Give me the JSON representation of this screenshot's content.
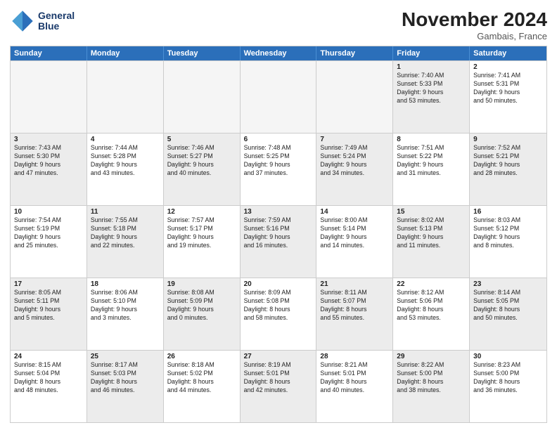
{
  "header": {
    "logo_line1": "General",
    "logo_line2": "Blue",
    "month": "November 2024",
    "location": "Gambais, France"
  },
  "weekdays": [
    "Sunday",
    "Monday",
    "Tuesday",
    "Wednesday",
    "Thursday",
    "Friday",
    "Saturday"
  ],
  "rows": [
    [
      {
        "day": "",
        "text": "",
        "empty": true
      },
      {
        "day": "",
        "text": "",
        "empty": true
      },
      {
        "day": "",
        "text": "",
        "empty": true
      },
      {
        "day": "",
        "text": "",
        "empty": true
      },
      {
        "day": "",
        "text": "",
        "empty": true
      },
      {
        "day": "1",
        "text": "Sunrise: 7:40 AM\nSunset: 5:33 PM\nDaylight: 9 hours\nand 53 minutes.",
        "shaded": true
      },
      {
        "day": "2",
        "text": "Sunrise: 7:41 AM\nSunset: 5:31 PM\nDaylight: 9 hours\nand 50 minutes.",
        "shaded": false
      }
    ],
    [
      {
        "day": "3",
        "text": "Sunrise: 7:43 AM\nSunset: 5:30 PM\nDaylight: 9 hours\nand 47 minutes.",
        "shaded": true
      },
      {
        "day": "4",
        "text": "Sunrise: 7:44 AM\nSunset: 5:28 PM\nDaylight: 9 hours\nand 43 minutes.",
        "shaded": false
      },
      {
        "day": "5",
        "text": "Sunrise: 7:46 AM\nSunset: 5:27 PM\nDaylight: 9 hours\nand 40 minutes.",
        "shaded": true
      },
      {
        "day": "6",
        "text": "Sunrise: 7:48 AM\nSunset: 5:25 PM\nDaylight: 9 hours\nand 37 minutes.",
        "shaded": false
      },
      {
        "day": "7",
        "text": "Sunrise: 7:49 AM\nSunset: 5:24 PM\nDaylight: 9 hours\nand 34 minutes.",
        "shaded": true
      },
      {
        "day": "8",
        "text": "Sunrise: 7:51 AM\nSunset: 5:22 PM\nDaylight: 9 hours\nand 31 minutes.",
        "shaded": false
      },
      {
        "day": "9",
        "text": "Sunrise: 7:52 AM\nSunset: 5:21 PM\nDaylight: 9 hours\nand 28 minutes.",
        "shaded": true
      }
    ],
    [
      {
        "day": "10",
        "text": "Sunrise: 7:54 AM\nSunset: 5:19 PM\nDaylight: 9 hours\nand 25 minutes.",
        "shaded": false
      },
      {
        "day": "11",
        "text": "Sunrise: 7:55 AM\nSunset: 5:18 PM\nDaylight: 9 hours\nand 22 minutes.",
        "shaded": true
      },
      {
        "day": "12",
        "text": "Sunrise: 7:57 AM\nSunset: 5:17 PM\nDaylight: 9 hours\nand 19 minutes.",
        "shaded": false
      },
      {
        "day": "13",
        "text": "Sunrise: 7:59 AM\nSunset: 5:16 PM\nDaylight: 9 hours\nand 16 minutes.",
        "shaded": true
      },
      {
        "day": "14",
        "text": "Sunrise: 8:00 AM\nSunset: 5:14 PM\nDaylight: 9 hours\nand 14 minutes.",
        "shaded": false
      },
      {
        "day": "15",
        "text": "Sunrise: 8:02 AM\nSunset: 5:13 PM\nDaylight: 9 hours\nand 11 minutes.",
        "shaded": true
      },
      {
        "day": "16",
        "text": "Sunrise: 8:03 AM\nSunset: 5:12 PM\nDaylight: 9 hours\nand 8 minutes.",
        "shaded": false
      }
    ],
    [
      {
        "day": "17",
        "text": "Sunrise: 8:05 AM\nSunset: 5:11 PM\nDaylight: 9 hours\nand 5 minutes.",
        "shaded": true
      },
      {
        "day": "18",
        "text": "Sunrise: 8:06 AM\nSunset: 5:10 PM\nDaylight: 9 hours\nand 3 minutes.",
        "shaded": false
      },
      {
        "day": "19",
        "text": "Sunrise: 8:08 AM\nSunset: 5:09 PM\nDaylight: 9 hours\nand 0 minutes.",
        "shaded": true
      },
      {
        "day": "20",
        "text": "Sunrise: 8:09 AM\nSunset: 5:08 PM\nDaylight: 8 hours\nand 58 minutes.",
        "shaded": false
      },
      {
        "day": "21",
        "text": "Sunrise: 8:11 AM\nSunset: 5:07 PM\nDaylight: 8 hours\nand 55 minutes.",
        "shaded": true
      },
      {
        "day": "22",
        "text": "Sunrise: 8:12 AM\nSunset: 5:06 PM\nDaylight: 8 hours\nand 53 minutes.",
        "shaded": false
      },
      {
        "day": "23",
        "text": "Sunrise: 8:14 AM\nSunset: 5:05 PM\nDaylight: 8 hours\nand 50 minutes.",
        "shaded": true
      }
    ],
    [
      {
        "day": "24",
        "text": "Sunrise: 8:15 AM\nSunset: 5:04 PM\nDaylight: 8 hours\nand 48 minutes.",
        "shaded": false
      },
      {
        "day": "25",
        "text": "Sunrise: 8:17 AM\nSunset: 5:03 PM\nDaylight: 8 hours\nand 46 minutes.",
        "shaded": true
      },
      {
        "day": "26",
        "text": "Sunrise: 8:18 AM\nSunset: 5:02 PM\nDaylight: 8 hours\nand 44 minutes.",
        "shaded": false
      },
      {
        "day": "27",
        "text": "Sunrise: 8:19 AM\nSunset: 5:01 PM\nDaylight: 8 hours\nand 42 minutes.",
        "shaded": true
      },
      {
        "day": "28",
        "text": "Sunrise: 8:21 AM\nSunset: 5:01 PM\nDaylight: 8 hours\nand 40 minutes.",
        "shaded": false
      },
      {
        "day": "29",
        "text": "Sunrise: 8:22 AM\nSunset: 5:00 PM\nDaylight: 8 hours\nand 38 minutes.",
        "shaded": true
      },
      {
        "day": "30",
        "text": "Sunrise: 8:23 AM\nSunset: 5:00 PM\nDaylight: 8 hours\nand 36 minutes.",
        "shaded": false
      }
    ]
  ]
}
